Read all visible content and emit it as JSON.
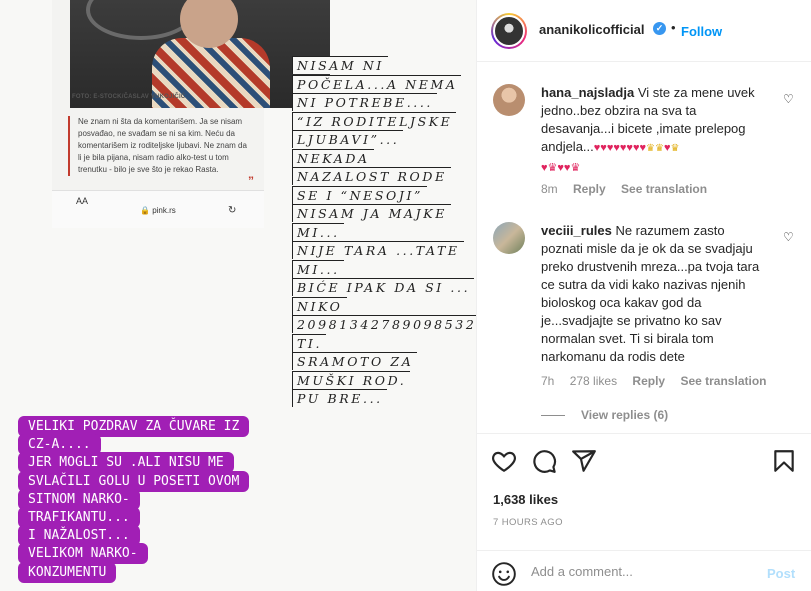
{
  "media": {
    "card": {
      "caption": "FOTO: E-STOCK/ČASLAV VUKOJIČIĆ",
      "quote": "Ne znam ni šta da komentarišem. Ja se nisam posvađao, ne svađam se ni sa kim. Neću da komentarišem iz roditeljske ljubavi. Ne znam da li je bila pijana, nisam radio alko-test u tom trenutku - bilo je sve što je rekao Rasta.",
      "quote_mark": "”",
      "aa": "AA",
      "url": "pink.rs",
      "lock_icon": "lock-icon",
      "reload_icon": "reload-icon"
    },
    "story_lines": [
      "NISAM NI",
      "POČELA...A NEMA",
      "NI POTREBE....",
      "“IZ RODITELJSKE",
      "LJUBAVI”...",
      "NEKADA",
      "NAZALOST RODE",
      "SE I “NESOJI”",
      "NISAM JA MAJKE",
      "MI...",
      "NIJE TARA ...TATE",
      "MI...",
      "BIĆE IPAK DA SI ...",
      "NIKO",
      "20981342789098532",
      "TI.",
      "SRAMOTO ZA",
      "MUŠKI ROD.",
      "PU BRE..."
    ],
    "purple_lines": [
      "VELIKI POZDRAV ZA ČUVARE IZ",
      "CZ-A....",
      "JER MOGLI SU .ALI NISU ME",
      "SVLAČILI GOLU U POSETI OVOM",
      "SITNOM NARKO-",
      "TRAFIKANTU...",
      "I NAŽALOST...",
      "VELIKOM NARKO-",
      "KONZUMENTU"
    ]
  },
  "header": {
    "username": "ananikolicofficial",
    "verified_icon": "verified-badge-icon",
    "separator": "•",
    "follow_label": "Follow"
  },
  "comments": [
    {
      "username": "hana_najsladja",
      "text": "Vi ste za mene uvek jedno..bez obzira na sva ta desavanja...i bicete ,imate prelepog andjela...",
      "emoji_row1": "♥♥♥♥♥♥♥♥",
      "emoji_row1_crowns": "♛♛",
      "emoji_row1_heart": "♥",
      "emoji_row1_crown_end": "♛",
      "emoji_row2": "♥♛♥♥♛",
      "time": "8m",
      "reply": "Reply",
      "see_translation": "See translation"
    },
    {
      "username": "veciii_rules",
      "text": "Ne razumem zasto poznati misle da je ok da se svadjaju preko drustvenih mreza...pa tvoja tara ce sutra da vidi kako nazivas njenih bioloskog oca kakav god da je...svadjajte se privatno ko sav normalan svet. Ti si birala tom narkomanu da rodis dete",
      "time": "7h",
      "likes": "278 likes",
      "reply": "Reply",
      "see_translation": "See translation"
    }
  ],
  "view_replies": "View replies (6)",
  "actions": {
    "likes": "1,638 likes",
    "time": "7 HOURS AGO"
  },
  "add_comment": {
    "placeholder": "Add a comment...",
    "post_label": "Post"
  },
  "colors": {
    "accent": "#0095f6",
    "story_purple": "#a11fb5",
    "heart": "#e0245e"
  }
}
